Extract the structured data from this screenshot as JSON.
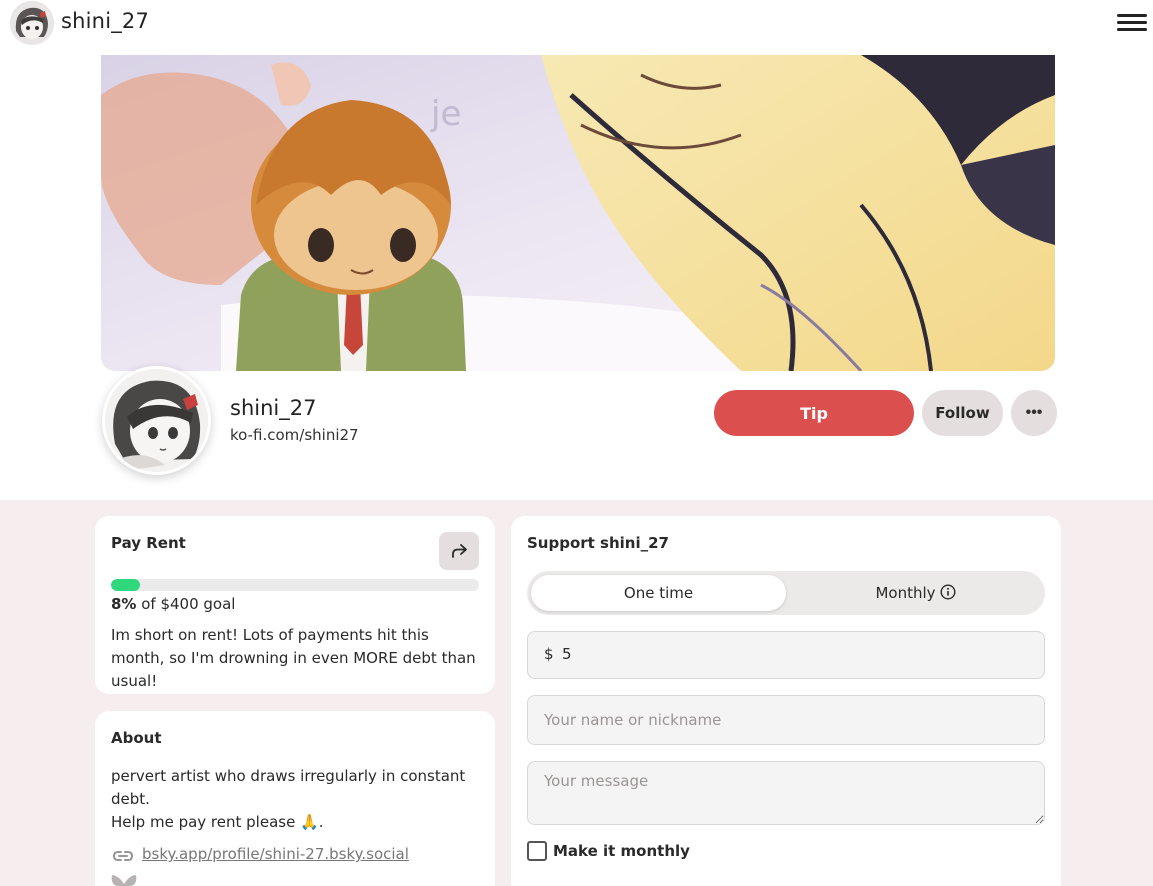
{
  "header": {
    "username": "shini_27"
  },
  "profile": {
    "name": "shini_27",
    "url": "ko-fi.com/shini27",
    "tip_label": "Tip",
    "follow_label": "Follow",
    "more_label": "•••"
  },
  "goal": {
    "title": "Pay Rent",
    "percent": 8,
    "percent_label": "8%",
    "goal_text": " of $400 goal",
    "description": "Im short on rent! Lots of payments hit this month, so I'm drowning in even MORE debt than usual!",
    "progress_color": "#2fd87c"
  },
  "about": {
    "title": "About",
    "text_line1": "pervert artist who draws irregularly in constant debt.",
    "text_line2": "Help me pay rent please 🙏.",
    "link": "bsky.app/profile/shini-27.bsky.social"
  },
  "support": {
    "title": "Support shini_27",
    "one_time_label": "One time",
    "monthly_label": "Monthly",
    "currency": "$",
    "amount": "5",
    "name_placeholder": "Your name or nickname",
    "message_placeholder": "Your message",
    "make_monthly_label": "Make it monthly"
  },
  "colors": {
    "accent": "#dc4f4f",
    "button_gray": "#e4dede",
    "section_bg": "#f6eeee"
  }
}
